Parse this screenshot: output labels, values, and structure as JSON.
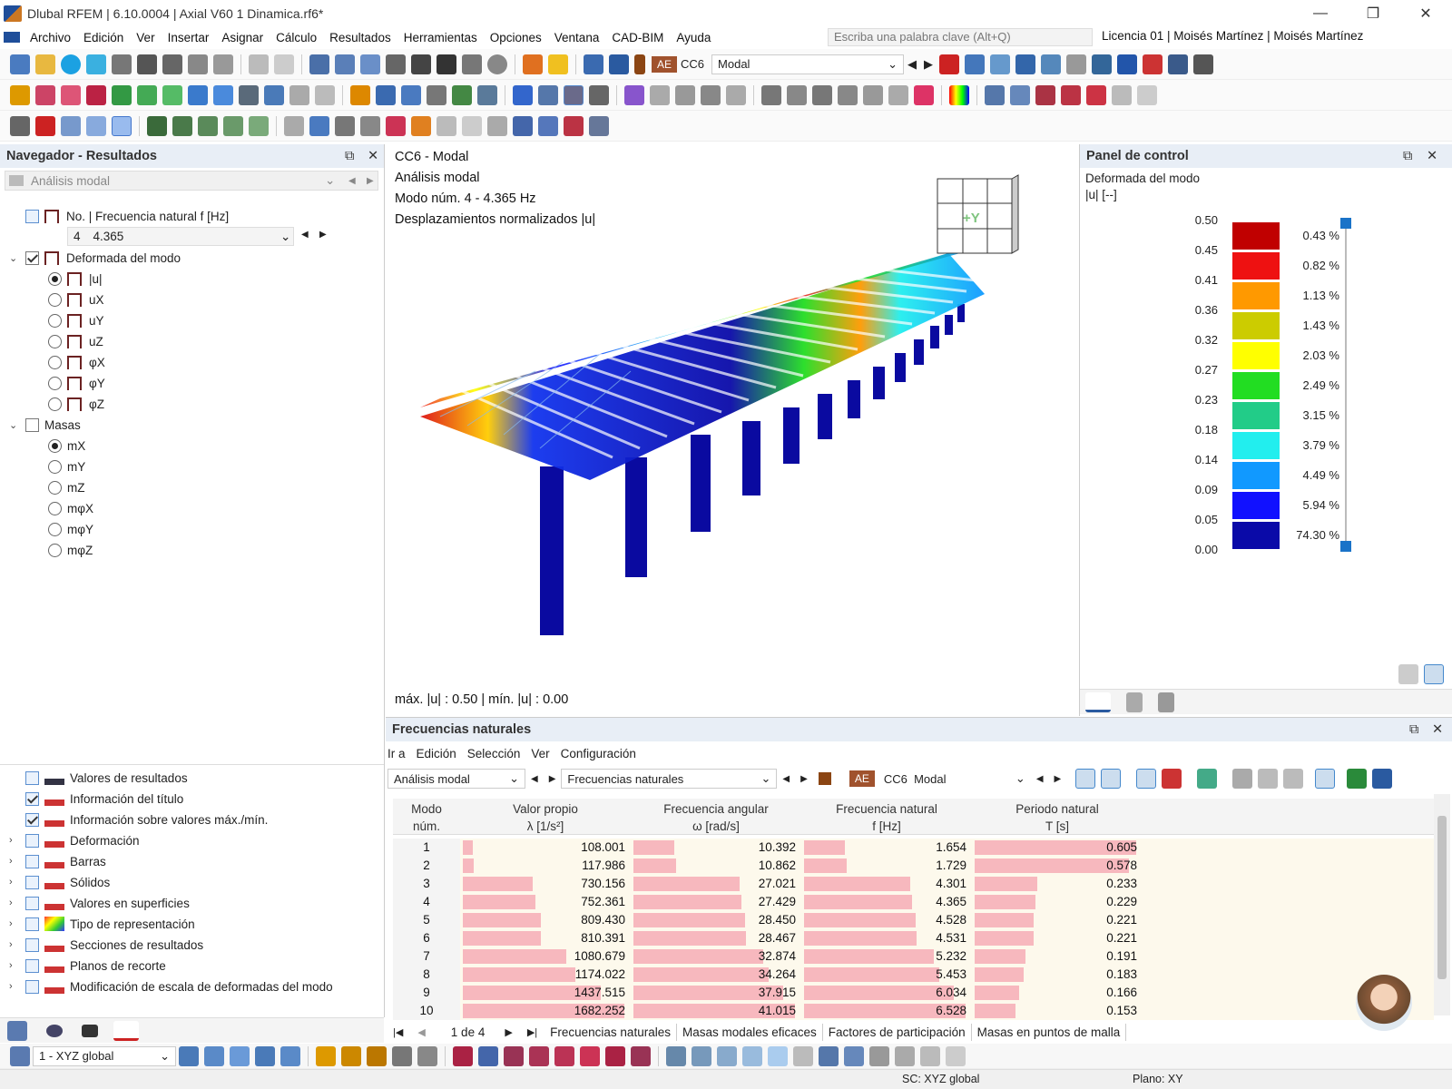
{
  "window": {
    "title": "Dlubal RFEM | 6.10.0004 | Axial V60 1 Dinamica.rf6*",
    "minimize": "—",
    "restore": "❐",
    "close": "✕"
  },
  "menu": {
    "items": [
      "Archivo",
      "Edición",
      "Ver",
      "Insertar",
      "Asignar",
      "Cálculo",
      "Resultados",
      "Herramientas",
      "Opciones",
      "Ventana",
      "CAD-BIM",
      "Ayuda"
    ],
    "search_placeholder": "Escriba una palabra clave (Alt+Q)",
    "license": "Licencia 01 | Moisés Martínez | Moisés Martínez"
  },
  "toolbar": {
    "load_type": "AE",
    "load_case": "CC6",
    "load_case_name": "Modal"
  },
  "navigator": {
    "title": "Navegador - Resultados",
    "analysis": "Análisis modal",
    "freq_header": "No. | Frecuencia natural f [Hz]",
    "mode_no": "4",
    "mode_freq": "4.365",
    "deformed_label": "Deformada del modo",
    "deformed_options": [
      "|u|",
      "uX",
      "uY",
      "uZ",
      "φX",
      "φY",
      "φZ"
    ],
    "masses_label": "Masas",
    "mass_options": [
      "mX",
      "mY",
      "mZ",
      "mφX",
      "mφY",
      "mφZ"
    ],
    "settings": [
      {
        "label": "Valores de resultados",
        "checked": false,
        "expand": false
      },
      {
        "label": "Información del título",
        "checked": true,
        "expand": false
      },
      {
        "label": "Información sobre valores máx./mín.",
        "checked": true,
        "expand": false
      },
      {
        "label": "Deformación",
        "checked": false,
        "expand": true
      },
      {
        "label": "Barras",
        "checked": false,
        "expand": true
      },
      {
        "label": "Sólidos",
        "checked": false,
        "expand": true
      },
      {
        "label": "Valores en superficies",
        "checked": false,
        "expand": true
      },
      {
        "label": "Tipo de representación",
        "checked": false,
        "expand": true
      },
      {
        "label": "Secciones de resultados",
        "checked": false,
        "expand": true
      },
      {
        "label": "Planos de recorte",
        "checked": false,
        "expand": true
      },
      {
        "label": "Modificación de escala de deformadas del modo",
        "checked": false,
        "expand": true
      }
    ]
  },
  "viewport": {
    "line1": "CC6 - Modal",
    "line2": "Análisis modal",
    "line3": "Modo núm. 4 - 4.365 Hz",
    "line4": "Desplazamientos normalizados |u|",
    "maxmin": "máx. |u| : 0.50 | mín. |u| : 0.00",
    "cube_label": "+Y"
  },
  "control_panel": {
    "title": "Panel de control",
    "subtitle1": "Deformada del modo",
    "subtitle2": "|u| [--]",
    "legend_values": [
      "0.50",
      "0.45",
      "0.41",
      "0.36",
      "0.32",
      "0.27",
      "0.23",
      "0.18",
      "0.14",
      "0.09",
      "0.05",
      "0.00"
    ],
    "legend_colors": [
      "#c00000",
      "#ee1111",
      "#ff9900",
      "#cccc00",
      "#ffff00",
      "#22dd22",
      "#22cc88",
      "#22eeee",
      "#1199ff",
      "#1111ff",
      "#0a0aa8"
    ],
    "legend_percents": [
      "0.43 %",
      "0.82 %",
      "1.13 %",
      "1.43 %",
      "2.03 %",
      "2.49 %",
      "3.15 %",
      "3.79 %",
      "4.49 %",
      "5.94 %",
      "74.30 %"
    ]
  },
  "table": {
    "title": "Frecuencias naturales",
    "menu": [
      "Ir a",
      "Edición",
      "Selección",
      "Ver",
      "Configuración"
    ],
    "analysis_select": "Análisis modal",
    "result_select": "Frecuencias naturales",
    "lc_type": "AE",
    "lc": "CC6",
    "lc_name": "Modal",
    "headers": [
      {
        "l1": "Modo",
        "l2": "núm."
      },
      {
        "l1": "Valor propio",
        "l2": "λ [1/s²]"
      },
      {
        "l1": "Frecuencia angular",
        "l2": "ω [rad/s]"
      },
      {
        "l1": "Frecuencia natural",
        "l2": "f [Hz]"
      },
      {
        "l1": "Periodo natural",
        "l2": "T [s]"
      }
    ],
    "rows": [
      [
        "1",
        "108.001",
        "10.392",
        "1.654",
        "0.605"
      ],
      [
        "2",
        "117.986",
        "10.862",
        "1.729",
        "0.578"
      ],
      [
        "3",
        "730.156",
        "27.021",
        "4.301",
        "0.233"
      ],
      [
        "4",
        "752.361",
        "27.429",
        "4.365",
        "0.229"
      ],
      [
        "5",
        "809.430",
        "28.450",
        "4.528",
        "0.221"
      ],
      [
        "6",
        "810.391",
        "28.467",
        "4.531",
        "0.221"
      ],
      [
        "7",
        "1080.679",
        "32.874",
        "5.232",
        "0.191"
      ],
      [
        "8",
        "1174.022",
        "34.264",
        "5.453",
        "0.183"
      ],
      [
        "9",
        "1437.515",
        "37.915",
        "6.034",
        "0.166"
      ],
      [
        "10",
        "1682.252",
        "41.015",
        "6.528",
        "0.153"
      ]
    ],
    "pager": "1 de 4",
    "tabs": [
      "Frecuencias naturales",
      "Masas modales eficaces",
      "Factores de participación",
      "Masas en puntos de malla"
    ]
  },
  "status": {
    "cs_select": "1 - XYZ global",
    "sc": "SC: XYZ global",
    "plane": "Plano: XY"
  }
}
